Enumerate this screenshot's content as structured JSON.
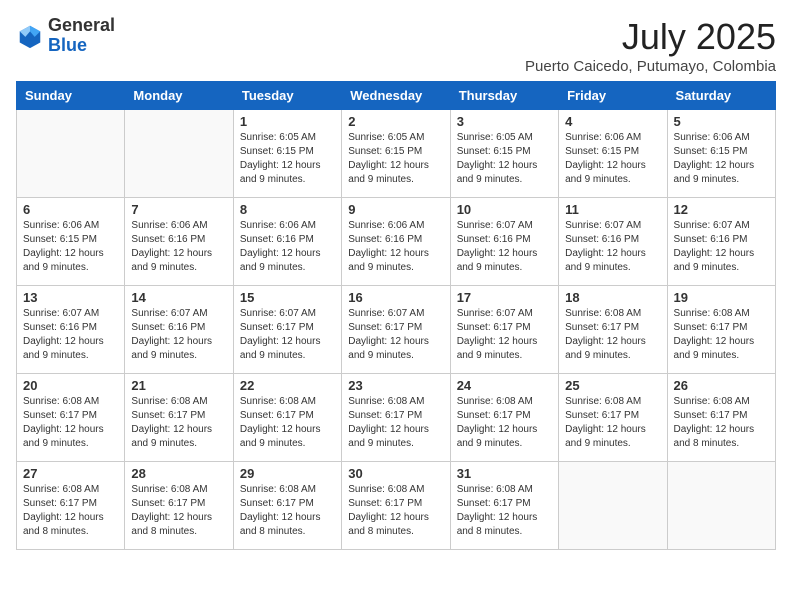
{
  "logo": {
    "general": "General",
    "blue": "Blue"
  },
  "title": {
    "month_year": "July 2025",
    "location": "Puerto Caicedo, Putumayo, Colombia"
  },
  "headers": [
    "Sunday",
    "Monday",
    "Tuesday",
    "Wednesday",
    "Thursday",
    "Friday",
    "Saturday"
  ],
  "weeks": [
    [
      {
        "day": "",
        "info": ""
      },
      {
        "day": "",
        "info": ""
      },
      {
        "day": "1",
        "info": "Sunrise: 6:05 AM\nSunset: 6:15 PM\nDaylight: 12 hours\nand 9 minutes."
      },
      {
        "day": "2",
        "info": "Sunrise: 6:05 AM\nSunset: 6:15 PM\nDaylight: 12 hours\nand 9 minutes."
      },
      {
        "day": "3",
        "info": "Sunrise: 6:05 AM\nSunset: 6:15 PM\nDaylight: 12 hours\nand 9 minutes."
      },
      {
        "day": "4",
        "info": "Sunrise: 6:06 AM\nSunset: 6:15 PM\nDaylight: 12 hours\nand 9 minutes."
      },
      {
        "day": "5",
        "info": "Sunrise: 6:06 AM\nSunset: 6:15 PM\nDaylight: 12 hours\nand 9 minutes."
      }
    ],
    [
      {
        "day": "6",
        "info": "Sunrise: 6:06 AM\nSunset: 6:15 PM\nDaylight: 12 hours\nand 9 minutes."
      },
      {
        "day": "7",
        "info": "Sunrise: 6:06 AM\nSunset: 6:16 PM\nDaylight: 12 hours\nand 9 minutes."
      },
      {
        "day": "8",
        "info": "Sunrise: 6:06 AM\nSunset: 6:16 PM\nDaylight: 12 hours\nand 9 minutes."
      },
      {
        "day": "9",
        "info": "Sunrise: 6:06 AM\nSunset: 6:16 PM\nDaylight: 12 hours\nand 9 minutes."
      },
      {
        "day": "10",
        "info": "Sunrise: 6:07 AM\nSunset: 6:16 PM\nDaylight: 12 hours\nand 9 minutes."
      },
      {
        "day": "11",
        "info": "Sunrise: 6:07 AM\nSunset: 6:16 PM\nDaylight: 12 hours\nand 9 minutes."
      },
      {
        "day": "12",
        "info": "Sunrise: 6:07 AM\nSunset: 6:16 PM\nDaylight: 12 hours\nand 9 minutes."
      }
    ],
    [
      {
        "day": "13",
        "info": "Sunrise: 6:07 AM\nSunset: 6:16 PM\nDaylight: 12 hours\nand 9 minutes."
      },
      {
        "day": "14",
        "info": "Sunrise: 6:07 AM\nSunset: 6:16 PM\nDaylight: 12 hours\nand 9 minutes."
      },
      {
        "day": "15",
        "info": "Sunrise: 6:07 AM\nSunset: 6:17 PM\nDaylight: 12 hours\nand 9 minutes."
      },
      {
        "day": "16",
        "info": "Sunrise: 6:07 AM\nSunset: 6:17 PM\nDaylight: 12 hours\nand 9 minutes."
      },
      {
        "day": "17",
        "info": "Sunrise: 6:07 AM\nSunset: 6:17 PM\nDaylight: 12 hours\nand 9 minutes."
      },
      {
        "day": "18",
        "info": "Sunrise: 6:08 AM\nSunset: 6:17 PM\nDaylight: 12 hours\nand 9 minutes."
      },
      {
        "day": "19",
        "info": "Sunrise: 6:08 AM\nSunset: 6:17 PM\nDaylight: 12 hours\nand 9 minutes."
      }
    ],
    [
      {
        "day": "20",
        "info": "Sunrise: 6:08 AM\nSunset: 6:17 PM\nDaylight: 12 hours\nand 9 minutes."
      },
      {
        "day": "21",
        "info": "Sunrise: 6:08 AM\nSunset: 6:17 PM\nDaylight: 12 hours\nand 9 minutes."
      },
      {
        "day": "22",
        "info": "Sunrise: 6:08 AM\nSunset: 6:17 PM\nDaylight: 12 hours\nand 9 minutes."
      },
      {
        "day": "23",
        "info": "Sunrise: 6:08 AM\nSunset: 6:17 PM\nDaylight: 12 hours\nand 9 minutes."
      },
      {
        "day": "24",
        "info": "Sunrise: 6:08 AM\nSunset: 6:17 PM\nDaylight: 12 hours\nand 9 minutes."
      },
      {
        "day": "25",
        "info": "Sunrise: 6:08 AM\nSunset: 6:17 PM\nDaylight: 12 hours\nand 9 minutes."
      },
      {
        "day": "26",
        "info": "Sunrise: 6:08 AM\nSunset: 6:17 PM\nDaylight: 12 hours\nand 8 minutes."
      }
    ],
    [
      {
        "day": "27",
        "info": "Sunrise: 6:08 AM\nSunset: 6:17 PM\nDaylight: 12 hours\nand 8 minutes."
      },
      {
        "day": "28",
        "info": "Sunrise: 6:08 AM\nSunset: 6:17 PM\nDaylight: 12 hours\nand 8 minutes."
      },
      {
        "day": "29",
        "info": "Sunrise: 6:08 AM\nSunset: 6:17 PM\nDaylight: 12 hours\nand 8 minutes."
      },
      {
        "day": "30",
        "info": "Sunrise: 6:08 AM\nSunset: 6:17 PM\nDaylight: 12 hours\nand 8 minutes."
      },
      {
        "day": "31",
        "info": "Sunrise: 6:08 AM\nSunset: 6:17 PM\nDaylight: 12 hours\nand 8 minutes."
      },
      {
        "day": "",
        "info": ""
      },
      {
        "day": "",
        "info": ""
      }
    ]
  ]
}
